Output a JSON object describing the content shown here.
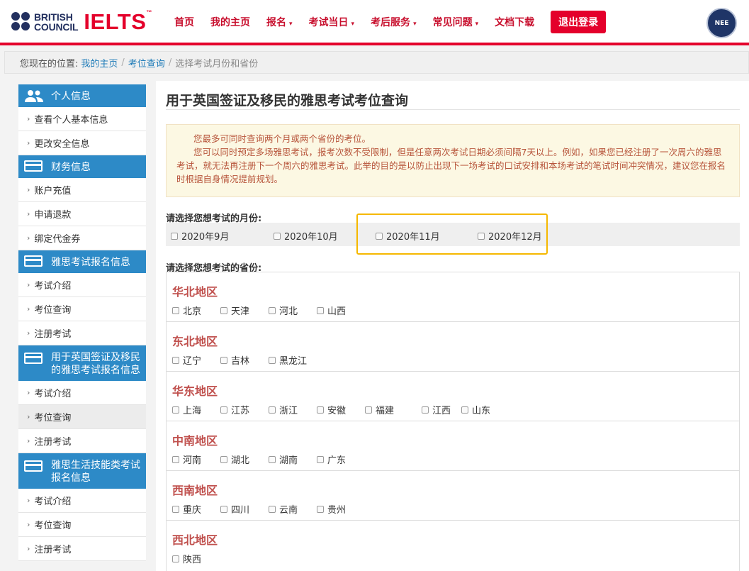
{
  "header": {
    "brand_line1": "BRITISH",
    "brand_line2": "COUNCIL",
    "brand_product": "IELTS",
    "brand_tm": "™",
    "nav": [
      {
        "label": "首页",
        "has_caret": false
      },
      {
        "label": "我的主页",
        "has_caret": false
      },
      {
        "label": "报名",
        "has_caret": true
      },
      {
        "label": "考试当日",
        "has_caret": true
      },
      {
        "label": "考后服务",
        "has_caret": true
      },
      {
        "label": "常见问题",
        "has_caret": true
      },
      {
        "label": "文档下载",
        "has_caret": false
      }
    ],
    "logout_label": "退出登录",
    "badge_text": "NEE",
    "colors": {
      "brand_red": "#e4002b",
      "brand_navy": "#23305f"
    }
  },
  "breadcrumb": {
    "prefix": "您现在的位置:",
    "links": [
      "我的主页",
      "考位查询"
    ],
    "current": "选择考试月份和省份"
  },
  "sidebar": {
    "sections": [
      {
        "title": "个人信息",
        "icon": "users-icon",
        "items": [
          "查看个人基本信息",
          "更改安全信息"
        ]
      },
      {
        "title": "财务信息",
        "icon": "card-icon",
        "items": [
          "账户充值",
          "申请退款",
          "绑定代金券"
        ]
      },
      {
        "title": "雅思考试报名信息",
        "icon": "card-icon",
        "items": [
          "考试介绍",
          "考位查询",
          "注册考试"
        ]
      },
      {
        "title": "用于英国签证及移民的雅思考试报名信息",
        "icon": "card-icon",
        "items": [
          "考试介绍",
          "考位查询",
          "注册考试"
        ]
      },
      {
        "title": "雅思生活技能类考试报名信息",
        "icon": "card-icon",
        "items": [
          "考试介绍",
          "考位查询",
          "注册考试"
        ]
      }
    ],
    "active": "sidebar-uk-visa-query",
    "colors": {
      "header_bg": "#2d8ac7"
    }
  },
  "main": {
    "title": "用于英国签证及移民的雅思考试考位查询",
    "notice": {
      "line1": "您最多可同时查询两个月或两个省份的考位。",
      "line2": "您可以同时预定多场雅思考试，报考次数不受限制，但是任意两次考试日期必须间隔7天以上。例如，如果您已经注册了一次周六的雅思考试，就无法再注册下一个周六的雅思考试。此举的目的是以防止出现下一场考试的口试安排和本场考试的笔试时间冲突情况，建议您在报名时根据自身情况提前规划。"
    },
    "month_label": "请选择您想考试的月份:",
    "months": [
      "2020年9月",
      "2020年10月",
      "2020年11月",
      "2020年12月"
    ],
    "province_label": "请选择您想考试的省份:",
    "regions": [
      {
        "name": "华北地区",
        "provinces": [
          "北京",
          "天津",
          "河北",
          "山西"
        ]
      },
      {
        "name": "东北地区",
        "provinces": [
          "辽宁",
          "吉林",
          "黑龙江"
        ]
      },
      {
        "name": "华东地区",
        "provinces": [
          "上海",
          "江苏",
          "浙江",
          "安徽",
          "福建",
          "江西",
          "山东"
        ]
      },
      {
        "name": "中南地区",
        "provinces": [
          "河南",
          "湖北",
          "湖南",
          "广东"
        ]
      },
      {
        "name": "西南地区",
        "provinces": [
          "重庆",
          "四川",
          "云南",
          "贵州"
        ]
      },
      {
        "name": "西北地区",
        "provinces": [
          "陕西"
        ]
      }
    ],
    "colors": {
      "region_title": "#c0504d",
      "notice_text": "#b7553b",
      "notice_bg": "#fcf8e3",
      "highlight": "#f5b800"
    }
  }
}
